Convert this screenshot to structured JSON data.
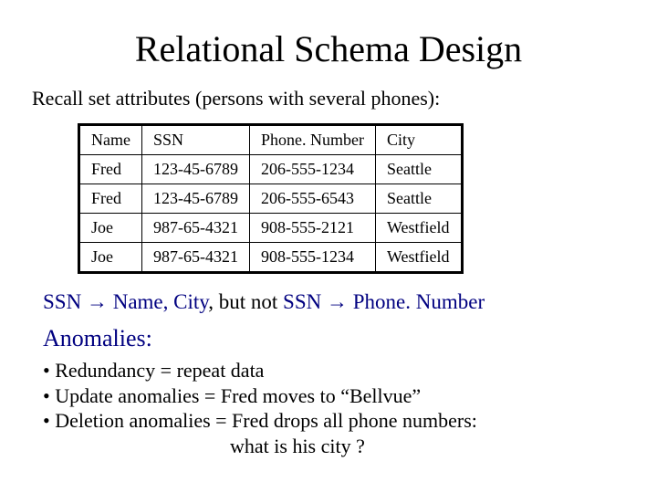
{
  "title": "Relational Schema Design",
  "subtitle": "Recall set attributes (persons with several phones):",
  "table": {
    "headers": [
      "Name",
      "SSN",
      "Phone. Number",
      "City"
    ],
    "rows": [
      [
        "Fred",
        "123-45-6789",
        "206-555-1234",
        "Seattle"
      ],
      [
        "Fred",
        "123-45-6789",
        "206-555-6543",
        "Seattle"
      ],
      [
        "Joe",
        "987-65-4321",
        "908-555-2121",
        "Westfield"
      ],
      [
        "Joe",
        "987-65-4321",
        "908-555-1234",
        "Westfield"
      ]
    ]
  },
  "fd": {
    "left1": "SSN ",
    "arrow1": "→",
    "mid1": " Name, City",
    "comma": ",   ",
    "but": "but not  ",
    "left2": "SSN ",
    "arrow2": "→",
    "right2": " Phone. Number"
  },
  "anomalies": {
    "heading": "Anomalies:",
    "items": [
      "• Redundancy        = repeat data",
      "• Update anomalies = Fred moves to “Bellvue”",
      "• Deletion anomalies = Fred drops all phone numbers:"
    ],
    "trailing": "what is his city ?"
  }
}
